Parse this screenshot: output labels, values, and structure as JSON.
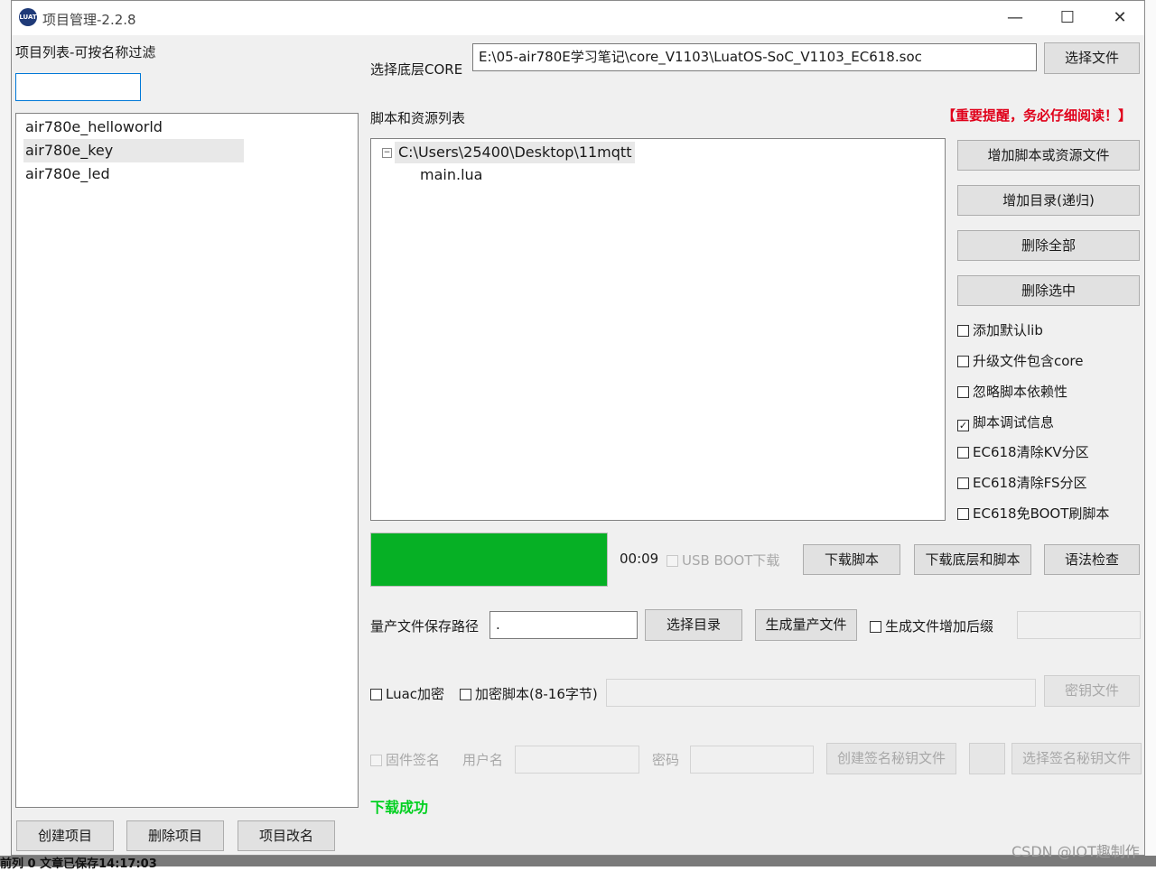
{
  "window": {
    "title": "项目管理-2.2.8",
    "icon_text": "LUAT"
  },
  "controls": {
    "minimize": "—",
    "maximize": "☐",
    "close": "✕"
  },
  "left": {
    "filter_label": "项目列表-可按名称过滤",
    "filter_value": "",
    "projects": [
      "air780e_helloworld",
      "air780e_key",
      "air780e_led"
    ],
    "selected_index": 1,
    "create_button": "创建项目",
    "delete_button": "删除项目",
    "rename_button": "项目改名"
  },
  "core": {
    "label": "选择底层CORE",
    "path": "E:\\05-air780E学习笔记\\core_V1103\\LuatOS-SoC_V1103_EC618.soc",
    "choose_button": "选择文件"
  },
  "scripts": {
    "label": "脚本和资源列表",
    "warning": "【重要提醒，务必仔细阅读！】",
    "tree_toggle": "−",
    "root_folder": "C:\\Users\\25400\\Desktop\\11mqtt",
    "files": [
      "main.lua"
    ]
  },
  "side_buttons": {
    "add_files": "增加脚本或资源文件",
    "add_dir": "增加目录(递归)",
    "delete_all": "删除全部",
    "delete_selected": "删除选中"
  },
  "options": [
    {
      "label": "添加默认lib",
      "checked": false
    },
    {
      "label": "升级文件包含core",
      "checked": false
    },
    {
      "label": "忽略脚本依赖性",
      "checked": false
    },
    {
      "label": "脚本调试信息",
      "checked": true
    },
    {
      "label": "EC618清除KV分区",
      "checked": false
    },
    {
      "label": "EC618清除FS分区",
      "checked": false
    },
    {
      "label": "EC618免BOOT刷脚本",
      "checked": false
    }
  ],
  "download": {
    "progress": 1.0,
    "progress_color": "#06b025",
    "time": "00:09",
    "usb_boot_label": "USB BOOT下载",
    "download_script": "下载脚本",
    "download_core_script": "下载底层和脚本",
    "syntax_check": "语法检查"
  },
  "production": {
    "path_label": "量产文件保存路径",
    "path_value": ".",
    "choose_dir": "选择目录",
    "generate": "生成量产文件",
    "suffix_label": "生成文件增加后缀",
    "suffix_value": ""
  },
  "encryption": {
    "luac_label": "Luac加密",
    "encrypt_label": "加密脚本(8-16字节)",
    "key_value": "",
    "key_file_button": "密钥文件"
  },
  "signing": {
    "firmware_sign": "固件签名",
    "username_label": "用户名",
    "username_value": "",
    "password_label": "密码",
    "password_value": "",
    "create_key_button": "创建签名秘钥文件",
    "select_key_button": "选择签名秘钥文件"
  },
  "status": {
    "message": "下载成功",
    "color": "#00d020"
  },
  "warning_color": "#e0001a",
  "background": {
    "bottom_text": "前列 0   文章已保存14:17:03",
    "watermark": "CSDN @IOT趣制作"
  }
}
